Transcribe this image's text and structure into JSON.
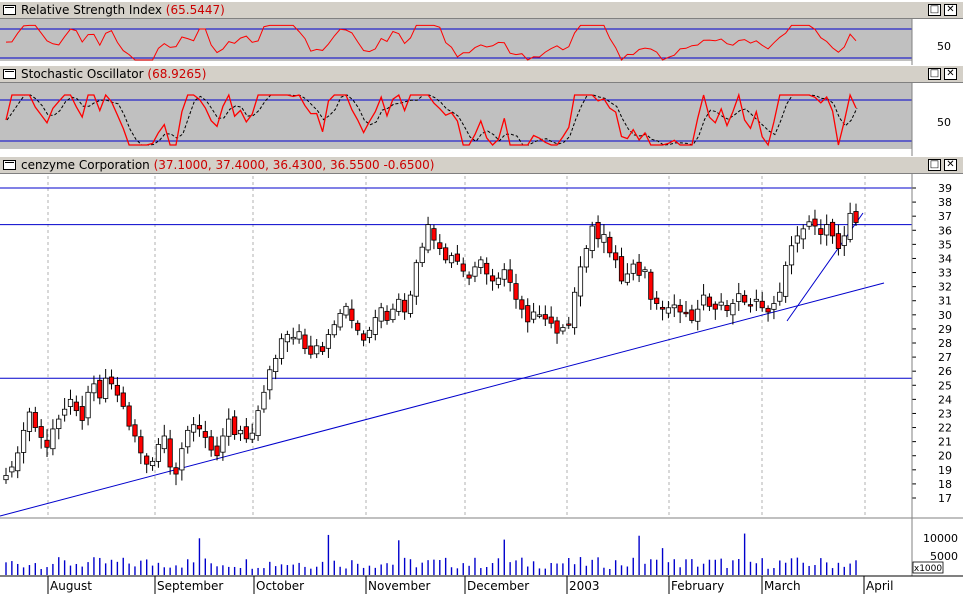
{
  "panes": {
    "rsi": {
      "title": "Relative Strength Index",
      "value": "(65.5447)",
      "level_label": "50"
    },
    "stoch": {
      "title": "Stochastic Oscillator",
      "value": "(68.9265)",
      "level_label": "50"
    },
    "price": {
      "title": "cenzyme Corporation",
      "value": "(37.1000, 37.4000, 36.4300, 36.5500 -0.6500)"
    },
    "volume": {
      "labels": [
        "10000",
        "5000"
      ],
      "unit": "x1000"
    }
  },
  "window_buttons": {
    "restore": "□",
    "close": "✕"
  },
  "colors": {
    "pane_bg": "#c0c0c0",
    "line_red": "#ff0000",
    "blue": "#0000cc",
    "up": "#ffffff",
    "down": "#ff0000"
  },
  "price_axis": {
    "min": 17,
    "max": 39,
    "ticks": [
      "39",
      "38",
      "37",
      "36",
      "35",
      "34",
      "33",
      "32",
      "31",
      "30",
      "29",
      "28",
      "27",
      "26",
      "25",
      "24",
      "23",
      "22",
      "21",
      "20",
      "19",
      "18",
      "17"
    ]
  },
  "months": [
    "August",
    "September",
    "October",
    "November",
    "December",
    "2003",
    "February",
    "March",
    "April"
  ],
  "chart_data": {
    "type": "candlestick",
    "title": "cenzyme Corporation",
    "last_bar": {
      "open": 37.1,
      "high": 37.4,
      "low": 36.43,
      "close": 36.55,
      "change": -0.65
    },
    "closes": [
      18.6,
      19.2,
      20.2,
      21.8,
      23.1,
      22.0,
      21.3,
      20.6,
      21.9,
      22.6,
      23.3,
      24.0,
      23.2,
      22.5,
      24.5,
      25.1,
      24.1,
      25.5,
      25.1,
      24.3,
      23.5,
      22.1,
      21.4,
      20.2,
      19.4,
      19.6,
      20.8,
      21.4,
      19.2,
      18.7,
      20.5,
      21.8,
      22.2,
      21.9,
      21.3,
      20.4,
      20.0,
      21.4,
      22.6,
      21.5,
      21.8,
      21.2,
      21.6,
      23.2,
      24.5,
      26.1,
      26.9,
      28.3,
      28.6,
      28.4,
      28.8,
      27.6,
      27.2,
      27.8,
      27.4,
      28.6,
      29.3,
      30.1,
      30.6,
      29.6,
      28.9,
      28.2,
      28.9,
      29.8,
      30.5,
      29.6,
      30.4,
      31.1,
      30.2,
      31.4,
      33.7,
      34.8,
      36.4,
      35.3,
      34.7,
      33.9,
      34.2,
      33.8,
      33.1,
      32.6,
      33.4,
      33.9,
      32.9,
      32.4,
      32.6,
      33.2,
      32.3,
      31.1,
      30.4,
      29.5,
      30.2,
      30.0,
      29.7,
      29.4,
      28.7,
      29.1,
      29.3,
      31.6,
      33.4,
      34.7,
      36.3,
      35.4,
      35.7,
      34.4,
      33.9,
      32.4,
      32.9,
      33.6,
      32.8,
      33.2,
      31.1,
      30.8,
      30.4,
      30.5,
      30.7,
      30.2,
      30.1,
      29.6,
      30.4,
      31.4,
      30.6,
      30.4,
      30.9,
      30.3,
      30.8,
      31.5,
      30.9,
      30.7,
      31.1,
      30.5,
      30.2,
      30.8,
      31.6,
      33.5,
      34.9,
      35.6,
      36.1,
      36.6,
      36.3,
      35.7,
      36.4,
      35.6,
      34.7,
      35.6,
      37.2,
      36.55
    ],
    "rsi_value": 65.5447,
    "stoch_value": 68.9265,
    "price_levels": [
      39.0,
      36.4,
      25.5
    ],
    "volume_unit": "x1000"
  }
}
